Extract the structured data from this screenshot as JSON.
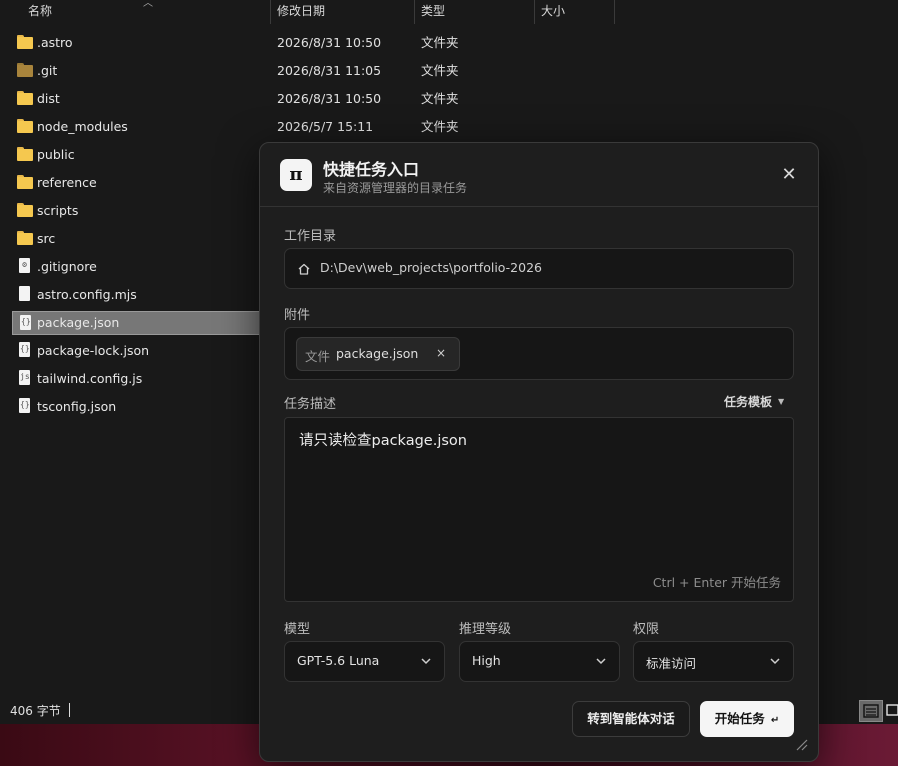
{
  "explorer": {
    "columns": {
      "name": "名称",
      "modified": "修改日期",
      "type": "类型",
      "size": "大小"
    },
    "files": [
      {
        "name": ".astro",
        "date": "2026/8/31 10:50",
        "type": "文件夹",
        "kind": "folder"
      },
      {
        "name": ".git",
        "date": "2026/8/31 11:05",
        "type": "文件夹",
        "kind": "folder-dim"
      },
      {
        "name": "dist",
        "date": "2026/8/31 10:50",
        "type": "文件夹",
        "kind": "folder"
      },
      {
        "name": "node_modules",
        "date": "2026/5/7 15:11",
        "type": "文件夹",
        "kind": "folder"
      },
      {
        "name": "public",
        "kind": "folder"
      },
      {
        "name": "reference",
        "kind": "folder"
      },
      {
        "name": "scripts",
        "kind": "folder"
      },
      {
        "name": "src",
        "kind": "folder"
      },
      {
        "name": ".gitignore",
        "kind": "file",
        "icon": "gear-file-icon"
      },
      {
        "name": "astro.config.mjs",
        "kind": "file",
        "icon": "document-icon"
      },
      {
        "name": "package.json",
        "kind": "file",
        "icon": "json-file-icon",
        "selected": true
      },
      {
        "name": "package-lock.json",
        "kind": "file",
        "icon": "json-file-icon"
      },
      {
        "name": "tailwind.config.js",
        "kind": "file",
        "icon": "js-file-icon"
      },
      {
        "name": "tsconfig.json",
        "kind": "file",
        "icon": "json-file-icon"
      }
    ],
    "status": {
      "size": "406 字节"
    }
  },
  "dialog": {
    "logo": "π",
    "title": "快捷任务入口",
    "subtitle": "来自资源管理器的目录任务",
    "close": "✕",
    "workdir": {
      "label": "工作目录",
      "path": "D:\\Dev\\web_projects\\portfolio-2026"
    },
    "attachments": {
      "label": "附件",
      "chip_kind": "文件",
      "chip_name": "package.json",
      "chip_remove": "×"
    },
    "task": {
      "label": "任务描述",
      "template_button": "任务模板",
      "text": "请只读检查package.json",
      "hint": "Ctrl + Enter 开始任务"
    },
    "model": {
      "label": "模型",
      "value": "GPT-5.6 Luna"
    },
    "reasoning": {
      "label": "推理等级",
      "value": "High"
    },
    "permission": {
      "label": "权限",
      "value": "标准访问"
    },
    "buttons": {
      "secondary": "转到智能体对话",
      "primary": "开始任务",
      "primary_icon": "↵"
    }
  }
}
